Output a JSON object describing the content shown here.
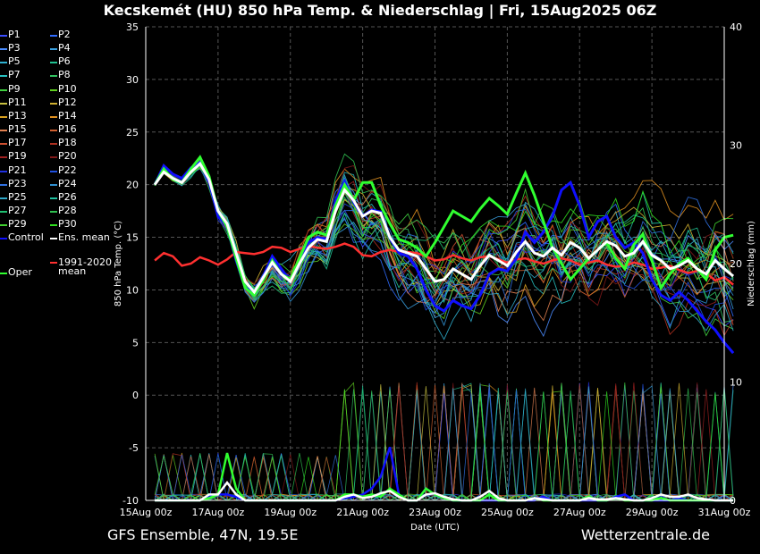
{
  "title": "Kecskemét  (HU)  850 hPa Temp. & Niederschlag | Fri, 15Aug2025 06Z",
  "footer": {
    "left": "GFS Ensemble, 47N, 19.5E",
    "right": "Wetterzentrale.de"
  },
  "legend": [
    {
      "label": "P1",
      "color": "#3a4dff"
    },
    {
      "label": "P2",
      "color": "#2f6bff"
    },
    {
      "label": "P3",
      "color": "#4b8cff"
    },
    {
      "label": "P4",
      "color": "#3aa0e0"
    },
    {
      "label": "P5",
      "color": "#2fb0d0"
    },
    {
      "label": "P6",
      "color": "#20c090"
    },
    {
      "label": "P7",
      "color": "#27c0c0"
    },
    {
      "label": "P8",
      "color": "#30c060"
    },
    {
      "label": "P9",
      "color": "#40d040"
    },
    {
      "label": "P10",
      "color": "#60d020"
    },
    {
      "label": "P11",
      "color": "#c8c040"
    },
    {
      "label": "P12",
      "color": "#d0b030"
    },
    {
      "label": "P13",
      "color": "#d8a020"
    },
    {
      "label": "P14",
      "color": "#e09020"
    },
    {
      "label": "P15",
      "color": "#e08050"
    },
    {
      "label": "P16",
      "color": "#d06030"
    },
    {
      "label": "P17",
      "color": "#d05030"
    },
    {
      "label": "P18",
      "color": "#b03020"
    },
    {
      "label": "P19",
      "color": "#a02020"
    },
    {
      "label": "P20",
      "color": "#801818"
    },
    {
      "label": "P21",
      "color": "#2030e0"
    },
    {
      "label": "P22",
      "color": "#2050e0"
    },
    {
      "label": "P23",
      "color": "#3070e0"
    },
    {
      "label": "P24",
      "color": "#3090d0"
    },
    {
      "label": "P25",
      "color": "#30a8c8"
    },
    {
      "label": "P26",
      "color": "#20c0a0"
    },
    {
      "label": "P27",
      "color": "#20c070"
    },
    {
      "label": "P28",
      "color": "#30c050"
    },
    {
      "label": "P29",
      "color": "#40d030"
    },
    {
      "label": "P30",
      "color": "#30e020"
    },
    {
      "label": "Control",
      "color": "#1010ff"
    },
    {
      "label": "Ens. mean",
      "color": "#ffffff"
    },
    {
      "label": "Oper",
      "color": "#30ff30"
    },
    {
      "label": "1991-2020 mean",
      "color": "#ff3030"
    }
  ],
  "chart_data": {
    "type": "line",
    "ylabel": "850 hPa Temp. (°C)",
    "y2label": "Niederschlag (mm)",
    "xlabel": "Date (UTC)",
    "ylim": [
      -10,
      35
    ],
    "y2lim": [
      0,
      40
    ],
    "yticks": [
      -10,
      -5,
      0,
      5,
      10,
      15,
      20,
      25,
      30,
      35
    ],
    "y2ticks": [
      0,
      10,
      20,
      30,
      40
    ],
    "xlim_hours": [
      0,
      384
    ],
    "xticks": [
      {
        "label": "15Aug 00z",
        "h": 0
      },
      {
        "label": "17Aug 00z",
        "h": 48
      },
      {
        "label": "19Aug 00z",
        "h": 96
      },
      {
        "label": "21Aug 00z",
        "h": 144
      },
      {
        "label": "23Aug 00z",
        "h": 192
      },
      {
        "label": "25Aug 00z",
        "h": 240
      },
      {
        "label": "27Aug 00z",
        "h": 288
      },
      {
        "label": "29Aug 00z",
        "h": 336
      },
      {
        "label": "31Aug 00z",
        "h": 384
      }
    ],
    "grid": true,
    "start_hour": 6,
    "step_hours": 6,
    "members_spread": 2.5,
    "ens_mean": [
      20,
      21.2,
      20.6,
      20.2,
      21.2,
      22.0,
      20.5,
      17.5,
      16.3,
      13.5,
      10.8,
      9.8,
      11.2,
      12.6,
      11.5,
      10.8,
      12.5,
      14.0,
      14.8,
      14.6,
      17.5,
      19.5,
      18.5,
      17.0,
      17.5,
      17.3,
      15.0,
      13.8,
      13.5,
      13.2,
      12.0,
      10.8,
      11.0,
      12.0,
      11.5,
      11.0,
      12.3,
      13.3,
      12.8,
      12.3,
      13.6,
      14.6,
      13.5,
      13.2,
      14.0,
      13.3,
      14.5,
      14.0,
      13.0,
      13.8,
      14.6,
      14.2,
      13.2,
      13.5,
      14.6,
      13.3,
      12.8,
      12.0,
      12.3,
      12.8,
      12.0,
      11.5,
      12.8,
      12.0,
      11.3
    ],
    "control": [
      20,
      21.8,
      21.0,
      20.6,
      21.6,
      22.1,
      20.3,
      17.0,
      16.0,
      12.8,
      10.2,
      9.8,
      11.3,
      13.2,
      12.0,
      10.8,
      13.0,
      14.5,
      15.0,
      14.8,
      18.5,
      20.3,
      18.3,
      17.0,
      17.6,
      17.4,
      15.0,
      13.5,
      13.2,
      12.0,
      10.0,
      8.5,
      8.0,
      9.0,
      8.5,
      8.2,
      9.5,
      11.5,
      12.0,
      11.8,
      13.0,
      15.5,
      14.5,
      15.5,
      17.0,
      19.5,
      20.2,
      18.0,
      15.0,
      16.5,
      17.0,
      15.0,
      14.0,
      14.5,
      13.5,
      11.0,
      9.5,
      9.0,
      9.8,
      9.0,
      8.0,
      7.0,
      6.2,
      5.0,
      4.0
    ],
    "oper": [
      20,
      21.5,
      20.5,
      20.2,
      21.5,
      22.6,
      20.8,
      17.5,
      16.0,
      13.0,
      10.2,
      9.5,
      11.0,
      12.8,
      11.5,
      11.0,
      13.0,
      15.0,
      15.5,
      15.2,
      18.0,
      20.0,
      18.5,
      20.2,
      20.2,
      18.0,
      16.3,
      14.8,
      14.5,
      14.0,
      13.2,
      14.5,
      16.0,
      17.5,
      17.0,
      16.5,
      17.7,
      18.7,
      18.0,
      17.2,
      19.2,
      21.1,
      19.0,
      16.5,
      14.0,
      12.5,
      11.0,
      12.0,
      13.0,
      13.8,
      14.5,
      13.0,
      12.0,
      14.3,
      15.3,
      12.8,
      10.2,
      11.5,
      12.5,
      13.0,
      12.0,
      11.0,
      13.8,
      15.0,
      15.2
    ],
    "clim_mean": [
      12.8,
      13.5,
      13.2,
      12.3,
      12.5,
      13.1,
      12.8,
      12.4,
      12.9,
      13.6,
      13.5,
      13.4,
      13.6,
      14.1,
      14.0,
      13.6,
      13.9,
      14.2,
      14.0,
      13.9,
      14.1,
      14.4,
      14.1,
      13.3,
      13.2,
      13.6,
      13.8,
      13.6,
      13.6,
      13.5,
      13.2,
      12.8,
      12.9,
      13.3,
      13.0,
      12.8,
      13.1,
      13.2,
      12.9,
      12.6,
      12.9,
      13.0,
      12.7,
      12.5,
      12.8,
      13.0,
      12.8,
      12.4,
      12.6,
      12.8,
      12.4,
      12.2,
      12.3,
      12.6,
      12.4,
      12.0,
      12.1,
      12.3,
      11.9,
      11.6,
      11.8,
      11.6,
      10.9,
      11.2,
      10.5
    ],
    "precip_ens_mean": [
      0,
      0,
      0,
      0,
      0,
      0,
      0.5,
      0.5,
      1.5,
      0.5,
      0,
      0,
      0,
      0,
      0,
      0,
      0,
      0,
      0,
      0,
      0,
      0.3,
      0.5,
      0.2,
      0.3,
      0.6,
      0.8,
      0.3,
      0,
      0,
      0.5,
      0.6,
      0.3,
      0.1,
      0,
      0,
      0.3,
      0.8,
      0.2,
      0,
      0,
      0,
      0.2,
      0.1,
      0,
      0,
      0,
      0,
      0.2,
      0.1,
      0.1,
      0.2,
      0.1,
      0,
      0,
      0.2,
      0.5,
      0.3,
      0.3,
      0.5,
      0.2,
      0.1,
      0,
      0,
      0
    ],
    "precip_control": [
      0,
      0,
      0,
      0,
      0,
      0,
      0.3,
      0.5,
      0.5,
      0.3,
      0,
      0,
      0,
      0,
      0,
      0,
      0,
      0,
      0,
      0,
      0,
      0.2,
      0.3,
      0.5,
      1.0,
      2.0,
      4.5,
      0.5,
      0,
      0,
      1.0,
      0.5,
      0.2,
      0,
      0,
      0,
      0,
      0,
      0,
      0,
      0,
      0,
      0,
      0.3,
      0,
      0,
      0,
      0,
      0,
      0,
      0,
      0.3,
      0.5,
      0,
      0,
      0,
      0,
      0,
      0.2,
      0,
      0,
      0,
      0,
      0,
      0
    ],
    "precip_oper": [
      0,
      0,
      0,
      0,
      0,
      0,
      0.2,
      0.5,
      4.0,
      1.0,
      0,
      0,
      0,
      0,
      0,
      0,
      0,
      0,
      0,
      0,
      0,
      0.5,
      0.5,
      0.3,
      0.5,
      0.3,
      1.0,
      0.5,
      0,
      0,
      1.0,
      0.5,
      0.2,
      0,
      0,
      0,
      0,
      0.5,
      0,
      0,
      0,
      0,
      0.2,
      0,
      0,
      0,
      0,
      0,
      0.3,
      0,
      0,
      0.2,
      0,
      0,
      0,
      0,
      0.2,
      0,
      0,
      0,
      0,
      0,
      0,
      0,
      0
    ]
  }
}
